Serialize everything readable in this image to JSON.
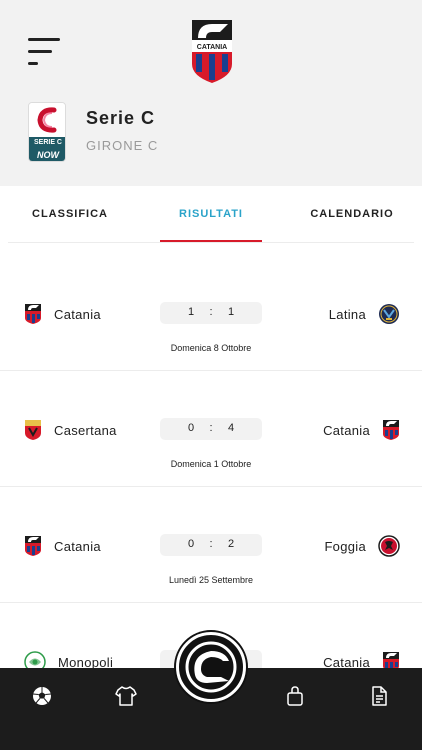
{
  "header": {
    "club_logo_icon": "catania-crest-icon",
    "club_logo_text": "CATANIA",
    "league": {
      "name": "Serie C",
      "group": "GIRONE C",
      "logo_icon": "serie-c-now-logo-icon",
      "logo_line1": "SERIE C",
      "logo_line2": "NOW"
    }
  },
  "tabs": [
    {
      "label": "CLASSIFICA"
    },
    {
      "label": "RISULTATI",
      "active": true
    },
    {
      "label": "CALENDARIO"
    }
  ],
  "colors": {
    "accent": "#2aa3c9",
    "underline": "#d71a2a",
    "bottom_bar": "#1c1c1c",
    "header_bg": "#f2f2f2"
  },
  "matches": [
    {
      "home": "Catania",
      "home_icon": "catania-crest-icon",
      "home_score": "1",
      "sep": ":",
      "away_score": "1",
      "away": "Latina",
      "away_icon": "latina-crest-icon",
      "date": "Domenica 8 Ottobre"
    },
    {
      "home": "Casertana",
      "home_icon": "casertana-crest-icon",
      "home_score": "0",
      "sep": ":",
      "away_score": "4",
      "away": "Catania",
      "away_icon": "catania-crest-icon",
      "date": "Domenica 1 Ottobre"
    },
    {
      "home": "Catania",
      "home_icon": "catania-crest-icon",
      "home_score": "0",
      "sep": ":",
      "away_score": "2",
      "away": "Foggia",
      "away_icon": "foggia-crest-icon",
      "date": "Lunedì 25 Settembre"
    },
    {
      "home": "Monopoli",
      "home_icon": "monopoli-crest-icon",
      "away": "Catania",
      "away_icon": "catania-crest-icon"
    }
  ],
  "bottom_nav": [
    {
      "icon": "football-icon"
    },
    {
      "icon": "jersey-icon"
    },
    {
      "icon": "catania-elephant-logo-icon"
    },
    {
      "icon": "shopping-bag-icon"
    },
    {
      "icon": "document-icon"
    }
  ]
}
